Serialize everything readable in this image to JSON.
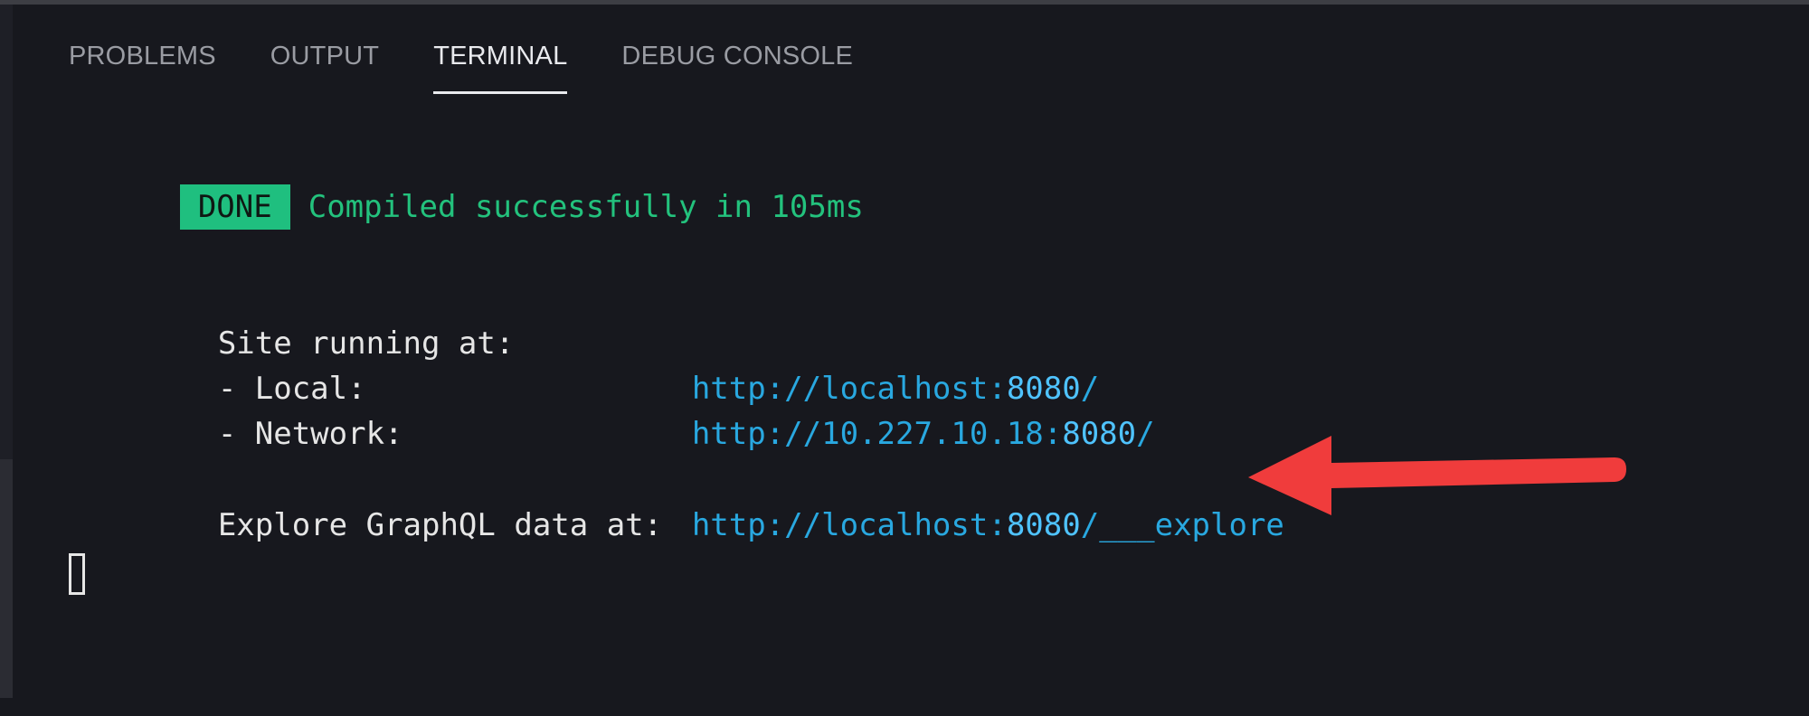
{
  "tabs": [
    {
      "label": "PROBLEMS"
    },
    {
      "label": "OUTPUT"
    },
    {
      "label": "TERMINAL",
      "active": true
    },
    {
      "label": "DEBUG CONSOLE"
    }
  ],
  "terminal": {
    "done_badge": "DONE",
    "compiled_message": "Compiled successfully in 105ms",
    "site_running": "Site running at:",
    "local_label": "- Local:",
    "local_url_prefix": "http://localhost:",
    "local_url_port": "8080",
    "local_url_suffix": "/",
    "network_label": "- Network:",
    "network_url_prefix": "http://10.227.10.18:",
    "network_url_port": "8080",
    "network_url_suffix": "/",
    "graphql_label": "Explore GraphQL data at:",
    "graphql_url_prefix": "http://localhost:",
    "graphql_url_port": "8080",
    "graphql_url_suffix": "/___explore"
  },
  "colors": {
    "background": "#17181e",
    "success": "#23c27d",
    "badge": "#1fbf7f",
    "url": "#29a8e0",
    "arrow": "#f03c3c"
  },
  "icons": {
    "annotation": "arrow-left-icon",
    "cursor": "terminal-cursor"
  }
}
